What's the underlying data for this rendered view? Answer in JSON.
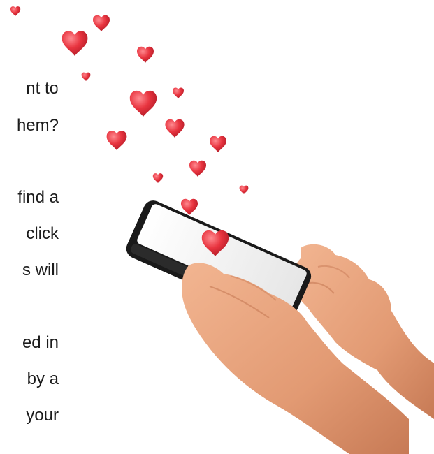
{
  "text_fragments": [
    "nt to",
    "hem?",
    "find a",
    "click",
    "s will",
    "ed in",
    "by a",
    "your"
  ],
  "colors": {
    "heart": "#e8343f",
    "heart_highlight": "#ff7b82",
    "skin": "#e8a27d",
    "skin_shadow": "#c77a55",
    "phone_body": "#1a1a1a",
    "phone_screen": "#f4f4f4",
    "text": "#1c1c1c"
  },
  "icons": [
    "heart-icon"
  ]
}
